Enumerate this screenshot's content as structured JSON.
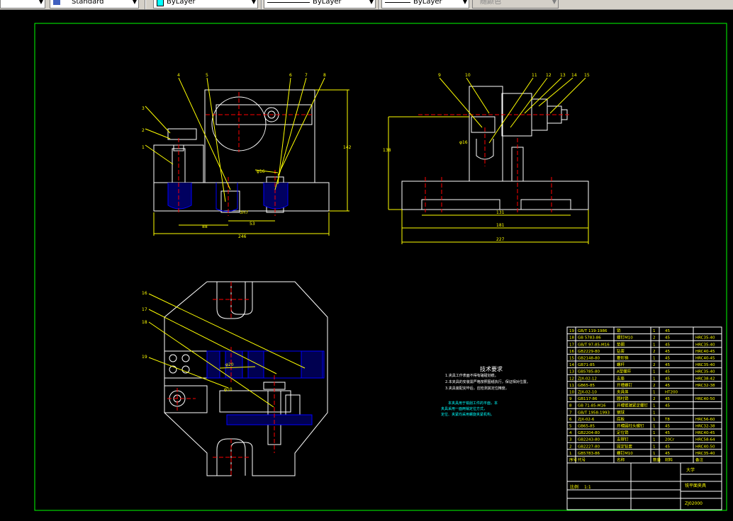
{
  "toolbar": {
    "text_style": "Standard",
    "layer_color": "ByLayer",
    "linetype": "ByLayer",
    "lineweight": "ByLayer",
    "plot_style": "随颜色"
  },
  "drawing": {
    "tech_requirements_title": "技术要求",
    "tech_requirements": [
      "1.夹具工作表面不得有磕碰划痕。",
      "2.本夹具的安装需严格按照图纸执行，保证相对位置。",
      "3.夹具装配完毕后，应检测其定位精度。"
    ],
    "note_lines": [
      "本夹具用于铣削工件的平面，本",
      "夹具采用一面两销定位方式，",
      "定位、夹紧均采用螺旋夹紧机构。"
    ],
    "front_dims": [
      "142",
      "53",
      "88",
      "246",
      "φ16",
      "3H7"
    ],
    "side_dims": [
      "138",
      "131",
      "181",
      "227",
      "φ16"
    ],
    "front_balloons": [
      "1",
      "2",
      "3",
      "4",
      "5",
      "6",
      "7",
      "8"
    ],
    "side_balloons": [
      "9",
      "10",
      "11",
      "12",
      "13",
      "14",
      "15"
    ],
    "top_balloons": [
      "16",
      "17",
      "18",
      "19"
    ],
    "top_dims": [
      "φ20",
      "φ10"
    ],
    "bom_rows": [
      {
        "no": "19",
        "code": "GB/T 119-1986",
        "name": "销",
        "qty": "1",
        "material": "45",
        "note": ""
      },
      {
        "no": "18",
        "code": "GB 5783-86",
        "name": "螺钉M10",
        "qty": "2",
        "material": "45",
        "note": "HRC35-40"
      },
      {
        "no": "17",
        "code": "GB/T 97-85-M16",
        "name": "垫圈",
        "qty": "1",
        "material": "45",
        "note": "HRC35-40"
      },
      {
        "no": "16",
        "code": "GB2229-80",
        "name": "钻套",
        "qty": "2",
        "material": "45",
        "note": "HRC40-45"
      },
      {
        "no": "15",
        "code": "GB2148-80",
        "name": "菱形销",
        "qty": "1",
        "material": "45",
        "note": "HRC40-45"
      },
      {
        "no": "14",
        "code": "GB71-85",
        "name": "螺杆",
        "qty": "2",
        "material": "45",
        "note": "HRC35-40"
      },
      {
        "no": "13",
        "code": "GB5785-80",
        "name": "A型螺杆",
        "qty": "1",
        "material": "45",
        "note": "HRC35-40"
      },
      {
        "no": "12",
        "code": "ZJX-02-12",
        "name": "支座",
        "qty": "1",
        "material": "45",
        "note": "HRC38-42"
      },
      {
        "no": "11",
        "code": "GB65-85",
        "name": "开槽螺钉",
        "qty": "2",
        "material": "45",
        "note": "HRC32-38"
      },
      {
        "no": "10",
        "code": "ZJX-02-10",
        "name": "夹具体",
        "qty": "1",
        "material": "HT200",
        "note": ""
      },
      {
        "no": "9",
        "code": "GB117-86",
        "name": "圆柱销",
        "qty": "2",
        "material": "45",
        "note": "HRC40-50"
      },
      {
        "no": "8",
        "code": "GB 71-85-M16",
        "name": "开槽锥端紧定螺钉",
        "qty": "1",
        "material": "45",
        "note": ""
      },
      {
        "no": "7",
        "code": "GB/T 1958-1993",
        "name": "钢球",
        "qty": "1",
        "material": "",
        "note": ""
      },
      {
        "no": "6",
        "code": "ZJX-02-6",
        "name": "底板",
        "qty": "1",
        "material": "T8",
        "note": "HRC56-60"
      },
      {
        "no": "5",
        "code": "GB65-85",
        "name": "开槽圆柱头螺钉",
        "qty": "1",
        "material": "45",
        "note": "HRC32-38"
      },
      {
        "no": "4",
        "code": "GB2204-80",
        "name": "定位销",
        "qty": "1",
        "material": "45",
        "note": "HRC40-45"
      },
      {
        "no": "3",
        "code": "GB2243-80",
        "name": "支撑钉",
        "qty": "1",
        "material": "20Cr",
        "note": "HRC58-64"
      },
      {
        "no": "2",
        "code": "GB2227-80",
        "name": "固定钻套",
        "qty": "1",
        "material": "45",
        "note": "HRC40-50"
      },
      {
        "no": "1",
        "code": "GB5783-86",
        "name": "螺钉M10",
        "qty": "1",
        "material": "45",
        "note": "HRC35-40"
      }
    ],
    "bom_header": {
      "no": "序号",
      "code": "代号",
      "name": "名称",
      "qty": "数量",
      "material": "材料",
      "note": "备注"
    },
    "title_block": {
      "school": "大学",
      "drawing_name": "铣平面夹具",
      "drawing_no": "ZJ02000",
      "scale_label": "比例",
      "scale": "1:1"
    }
  },
  "colors": {
    "yellow": "#ffff00",
    "white": "#ffffff",
    "red": "#ff0000",
    "blue": "#0000ff",
    "green": "#00ff00",
    "magenta": "#ff00ff"
  }
}
